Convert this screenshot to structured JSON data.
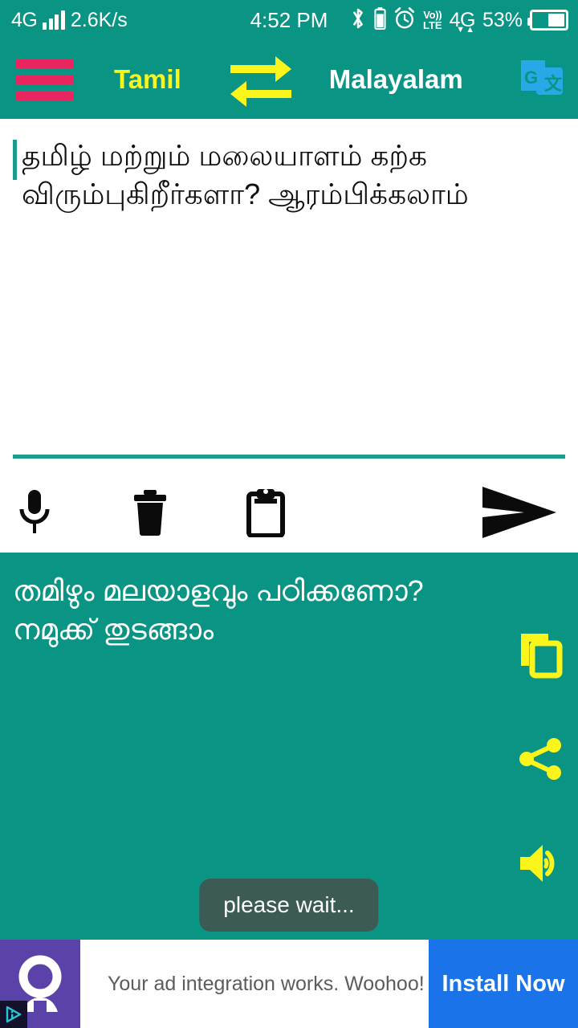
{
  "status_bar": {
    "network_type": "4G",
    "data_speed": "2.6K/s",
    "time": "4:52 PM",
    "volte_line1": "Vo))",
    "volte_line2": "LTE",
    "network_right": "4G",
    "arrow_down": "▼",
    "arrow_up": "▲",
    "battery_percent": "53%",
    "battery_level": 53,
    "icons": [
      "signal-bars-icon",
      "bluetooth-icon",
      "battery-small-icon",
      "alarm-clock-icon",
      "volte-icon",
      "network-4g-icon",
      "battery-icon"
    ]
  },
  "app_bar": {
    "menu_icon": "hamburger-menu-icon",
    "source_language": "Tamil",
    "swap_icon": "swap-languages-icon",
    "target_language": "Malayalam",
    "translate_icon": "google-translate-icon",
    "colors": {
      "background": "#0A9484",
      "menu": "#E8255F",
      "source_text": "#FBF51C",
      "swap": "#FBF51C",
      "target_text": "#FFFFFF",
      "translate_icon": "#29A8E8"
    }
  },
  "input": {
    "text": "தமிழ் மற்றும் மலையாளம் கற்க விரும்புகிறீர்களா? ஆரம்பிக்கலாம்",
    "placeholder": "",
    "caret_color": "#1A9C8C"
  },
  "toolbar": {
    "mic_label": "microphone-icon",
    "delete_label": "trash-icon",
    "paste_label": "clipboard-icon",
    "send_label": "send-icon"
  },
  "output": {
    "text": "തമിഴും മലയാളവും പഠിക്കണോ? നമുക്ക് തുടങ്ങാം",
    "actions": {
      "copy_label": "copy-icon",
      "share_label": "share-icon",
      "speak_label": "speaker-icon"
    },
    "colors": {
      "background": "#0A9484",
      "text": "#FFFFFF",
      "action_icons": "#FBF51C"
    }
  },
  "toast": {
    "message": "please wait...",
    "background": "#3C5B54"
  },
  "ad": {
    "icon_label": "advertiser-avatar-icon",
    "adchoices_label": "adchoices-icon",
    "text": "Your ad integration works. Woohoo!",
    "cta_label": "Install Now",
    "colors": {
      "icon_box": "#5B42A8",
      "cta": "#1A73E8",
      "text": "#5C5C5C"
    }
  }
}
